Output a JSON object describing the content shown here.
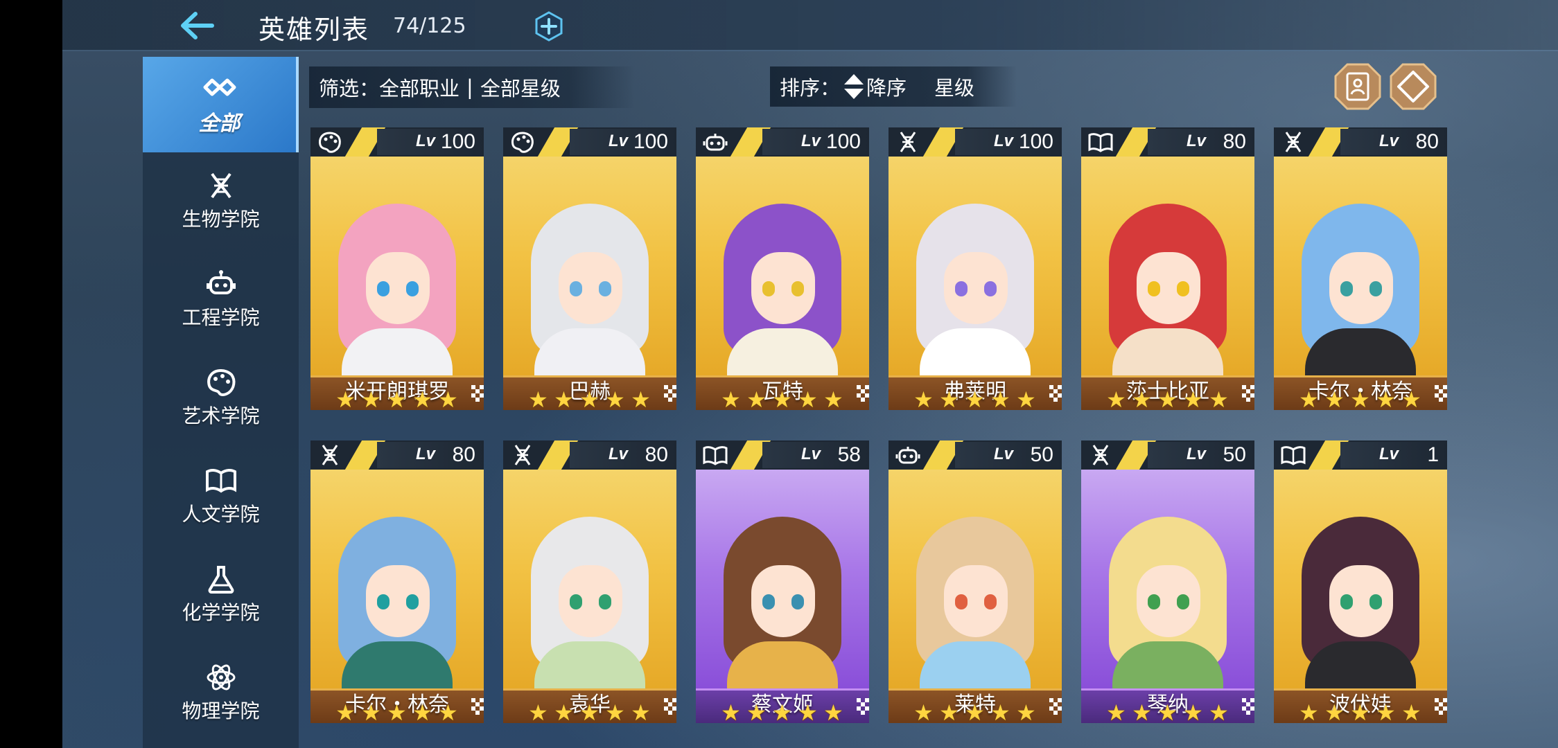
{
  "header": {
    "title": "英雄列表",
    "count": "74/125"
  },
  "sidebar": {
    "items": [
      {
        "label": "全部",
        "icon": "all-icon",
        "active": true
      },
      {
        "label": "生物学院",
        "icon": "dna-icon",
        "active": false
      },
      {
        "label": "工程学院",
        "icon": "robot-icon",
        "active": false
      },
      {
        "label": "艺术学院",
        "icon": "palette-icon",
        "active": false
      },
      {
        "label": "人文学院",
        "icon": "book-icon",
        "active": false
      },
      {
        "label": "化学学院",
        "icon": "flask-icon",
        "active": false
      },
      {
        "label": "物理学院",
        "icon": "atom-icon",
        "active": false
      }
    ]
  },
  "filter": {
    "label": "筛选：",
    "class_value": "全部职业",
    "separator": "|",
    "star_value": "全部星级"
  },
  "sort": {
    "label": "排序：",
    "order": "降序",
    "key": "星级"
  },
  "level_prefix": "Lv",
  "heroes": [
    {
      "name": "米开朗琪罗",
      "level": "100",
      "class_icon": "palette-icon",
      "stars": 5,
      "frame": "gold"
    },
    {
      "name": "巴赫",
      "level": "100",
      "class_icon": "palette-icon",
      "stars": 5,
      "frame": "gold"
    },
    {
      "name": "瓦特",
      "level": "100",
      "class_icon": "robot-icon",
      "stars": 5,
      "frame": "gold"
    },
    {
      "name": "弗莱明",
      "level": "100",
      "class_icon": "dna-icon",
      "stars": 5,
      "frame": "gold"
    },
    {
      "name": "莎士比亚",
      "level": "80",
      "class_icon": "book-icon",
      "stars": 5,
      "frame": "gold"
    },
    {
      "name": "卡尔・林奈",
      "level": "80",
      "class_icon": "dna-icon",
      "stars": 5,
      "frame": "gold"
    },
    {
      "name": "卡尔・林奈",
      "level": "80",
      "class_icon": "dna-icon",
      "stars": 5,
      "frame": "gold"
    },
    {
      "name": "袁华",
      "level": "80",
      "class_icon": "dna-icon",
      "stars": 5,
      "frame": "gold"
    },
    {
      "name": "蔡文姬",
      "level": "58",
      "class_icon": "book-icon",
      "stars": 5,
      "frame": "purple"
    },
    {
      "name": "莱特",
      "level": "50",
      "class_icon": "robot-icon",
      "stars": 5,
      "frame": "gold"
    },
    {
      "name": "琴纳",
      "level": "50",
      "class_icon": "dna-icon",
      "stars": 5,
      "frame": "purple"
    },
    {
      "name": "波伏娃",
      "level": "1",
      "class_icon": "book-icon",
      "stars": 5,
      "frame": "gold"
    }
  ],
  "colors": {
    "accent_blue": "#3a8fdc",
    "star": "#ffd540",
    "gold_frame": "#e7b14a",
    "purple_frame": "#8a4fd9"
  }
}
